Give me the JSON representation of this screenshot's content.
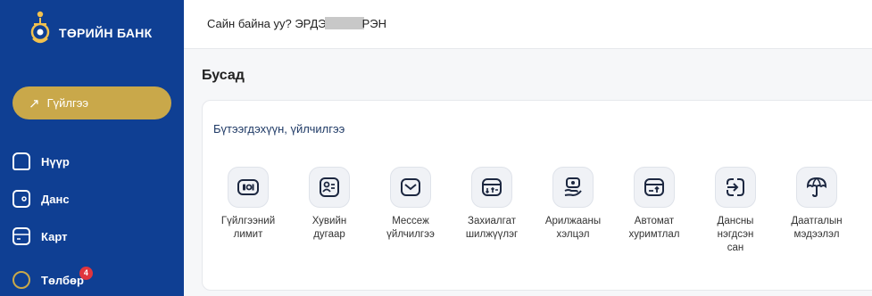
{
  "brand": {
    "name": "ТӨРИЙН БАНК"
  },
  "header": {
    "greeting_prefix": "Сайн байна уу? ЭРДЭ",
    "greeting_suffix": "РЭН"
  },
  "sidebar": {
    "active": {
      "label": "Гүйлгээ"
    },
    "items": [
      {
        "label": "Нүүр",
        "icon": "home-icon"
      },
      {
        "label": "Данс",
        "icon": "wallet-icon"
      },
      {
        "label": "Карт",
        "icon": "card-icon"
      },
      {
        "label": "Төлбөр",
        "icon": "bulb-icon",
        "badge": "4"
      }
    ]
  },
  "page": {
    "title": "Бусад"
  },
  "section": {
    "title": "Бүтээгдэхүүн, үйлчилгээ"
  },
  "services": [
    {
      "label": "Гүйлгээний\nлимит",
      "icon": "limit-icon"
    },
    {
      "label": "Хувийн\nдугаар",
      "icon": "id-card-icon"
    },
    {
      "label": "Мессеж\nүйлчилгээ",
      "icon": "mail-icon"
    },
    {
      "label": "Захиалгат\nшилжүүлэг",
      "icon": "scheduled-transfer-icon"
    },
    {
      "label": "Арилжааны\nхэлцэл",
      "icon": "money-hand-icon"
    },
    {
      "label": "Автомат\nхуримтлал",
      "icon": "auto-savings-icon"
    },
    {
      "label": "Дансны\nнэгдсэн\nсан",
      "icon": "account-login-icon"
    },
    {
      "label": "Даатгалын\nмэдээлэл",
      "icon": "umbrella-icon"
    }
  ],
  "colors": {
    "sidebar": "#0f3f93",
    "accent": "#c9a84a",
    "badge": "#e0353d"
  }
}
